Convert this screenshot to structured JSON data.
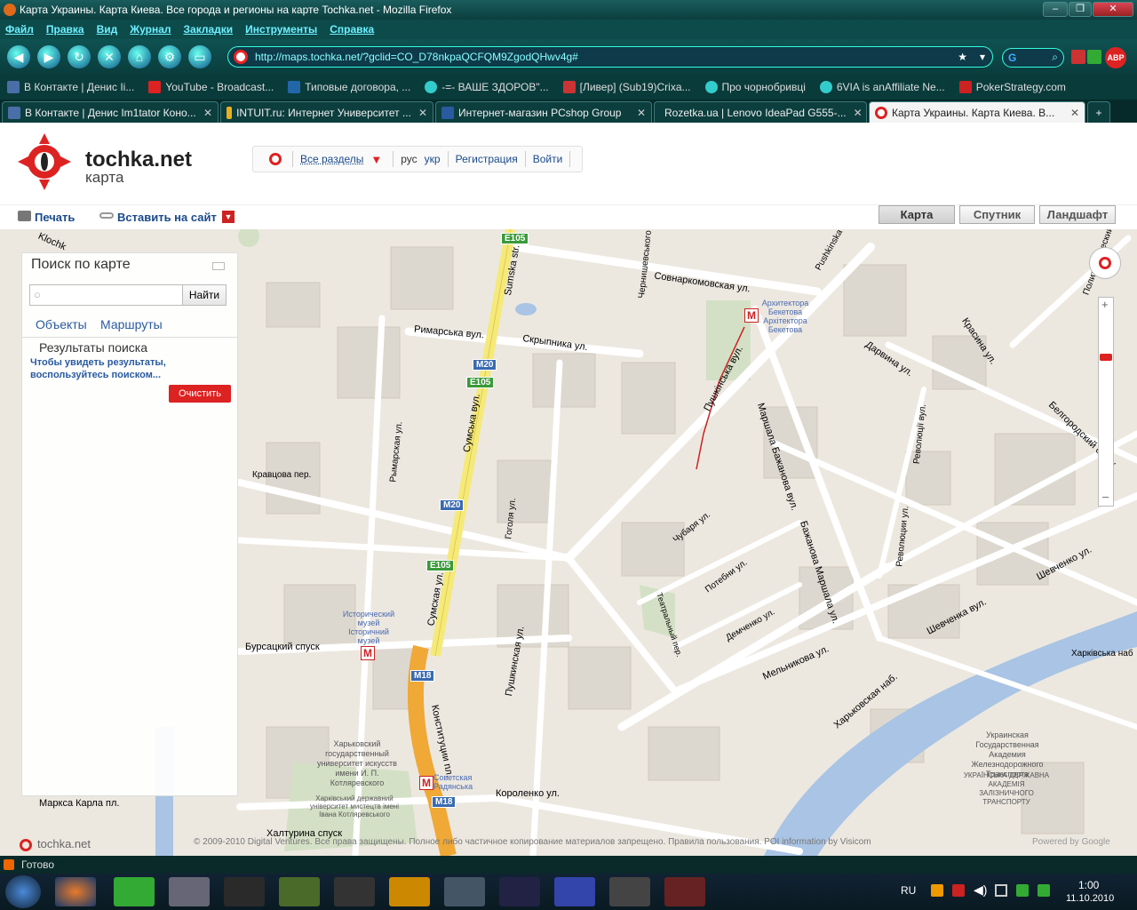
{
  "window": {
    "title": "Карта Украины. Карта Киева. Все города и регионы на карте Tochka.net - Mozilla Firefox"
  },
  "menu": [
    "Файл",
    "Правка",
    "Вид",
    "Журнал",
    "Закладки",
    "Инструменты",
    "Справка"
  ],
  "url": "http://maps.tochka.net/?gclid=CO_D78nkpaQCFQM9ZgodQHwv4g#",
  "bookmarks": [
    {
      "label": "В Контакте | Денис Ii...",
      "color": "#4a6ea8"
    },
    {
      "label": "YouTube - Broadcast...",
      "color": "#d22"
    },
    {
      "label": "Типовые договора, ...",
      "color": "#2266aa"
    },
    {
      "label": "-=- ВАШЕ ЗДОРОВ\"...",
      "color": "#3cc"
    },
    {
      "label": "[Ливер] (Sub19)Crixa...",
      "color": "#c33"
    },
    {
      "label": "Про чорнобривці",
      "color": "#3cc"
    },
    {
      "label": "6VIA is anAffiliate Ne...",
      "color": "#3cc"
    },
    {
      "label": "PokerStrategy.com",
      "color": "#c22"
    }
  ],
  "tabs": [
    {
      "label": "В Контакте | Денис Im1tator Коно...",
      "active": false,
      "color": "#4a6ea8"
    },
    {
      "label": "INTUIT.ru: Интернет Университет ...",
      "active": false,
      "color": "#e8b020"
    },
    {
      "label": "Интернет-магазин PCshop Group",
      "active": false,
      "color": "#2a5aa0"
    },
    {
      "label": "Rozetka.ua | Lenovo IdeaPad G555-...",
      "active": false,
      "color": "#6a3"
    },
    {
      "label": "Карта Украины. Карта Киева. В...",
      "active": true,
      "color": "#d22"
    }
  ],
  "site": {
    "brand": "tochka.net",
    "brand_sub": "карта",
    "nav_sections": "Все разделы",
    "lang_ru": "рус",
    "lang_ua": "укр",
    "register": "Регистрация",
    "login": "Войти",
    "print": "Печать",
    "embed": "Вставить на сайт",
    "map_types": [
      "Карта",
      "Спутник",
      "Ландшафт"
    ]
  },
  "panel": {
    "title": "Поиск по карте",
    "search_button": "Найти",
    "tab_objects": "Объекты",
    "tab_routes": "Маршруты",
    "results_title": "Результаты поиска",
    "results_hint": "Чтобы увидеть результаты, воспользуйтесь поиском...",
    "clear_button": "Очистить"
  },
  "map": {
    "footer_logo": "tochka.net",
    "copyright": "© 2009-2010 Digital Ventures. Все права защищены. Полное либо частичное копирование материалов запрещено. Правила пользования. POI information by Visicom",
    "powered": "Powered by Google",
    "streets": {
      "sovnarkom": "Совнаркомовская ул.",
      "rymarska": "Римарська вул.",
      "skrypnyka": "Скрыпника ул.",
      "sumska": "Сумська вул.",
      "sumska_str": "Sumska str.",
      "sumskaya": "Сумская ул.",
      "konstytutsii": "Конституции пл.",
      "pushkinska": "Пушкінська вул.",
      "pushkinskaya": "Пушкинская ул.",
      "marshala": "Маршала Бажанова вул.",
      "bazhanova": "Бажанова Маршала ул.",
      "chubarya": "Чубаря ул.",
      "potebni": "Потебни ул.",
      "demchenko": "Демченко ул.",
      "melnikova": "Мельникова ул.",
      "kharkivska_nab": "Харьковская наб.",
      "shevchenka": "Шевченка вул.",
      "shevchenko": "Шевченко ул.",
      "darvina": "Дарвина ул.",
      "krasina": "Красина ул.",
      "belgorodsky": "Белгородский спуск",
      "revolutsii": "Революции ул.",
      "revolutsii2": "Революції вул.",
      "kravtsova": "Кравцова пер.",
      "burs": "Бурсацкий спуск",
      "korolenko": "Короленко ул.",
      "marksa": "Маркса Карла пл.",
      "khalturina": "Халтурина спуск",
      "gogolya": "Гоголя ул.",
      "rymarska_ul": "Рымарская ул.",
      "pushkinska_top": "Pushkinska",
      "chernyshevsk": "Чернишевського",
      "teatr": "Театральный пер.",
      "politekh": "Политехнический",
      "kharkivska_top": "Харківська наб",
      "klochk": "Klochk"
    },
    "road_badges": {
      "e105": "E105",
      "m20": "M20",
      "m18": "M18"
    },
    "pois": {
      "museum": "Исторический музей Історичний музей",
      "metro1": "Архитектора Бекетова Архітектора Бекетова",
      "metro3": "Советская Радянська",
      "university": "Харьковский государственный университет искусств имени И. П. Котляревского",
      "university_ua": "Харківський державний університет мистецтв імені Івана Котляревського",
      "academy": "Украинская Государственная Академия Железнодорожного Транспорта",
      "academy_ua": "УКРАЇНСЬКА ДЕРЖАВНА АКАДЕМІЯ ЗАЛІЗНИЧНОГО ТРАНСПОРТУ"
    }
  },
  "status": "Готово",
  "tray": {
    "lang": "RU",
    "time": "1:00",
    "date": "11.10.2010"
  }
}
